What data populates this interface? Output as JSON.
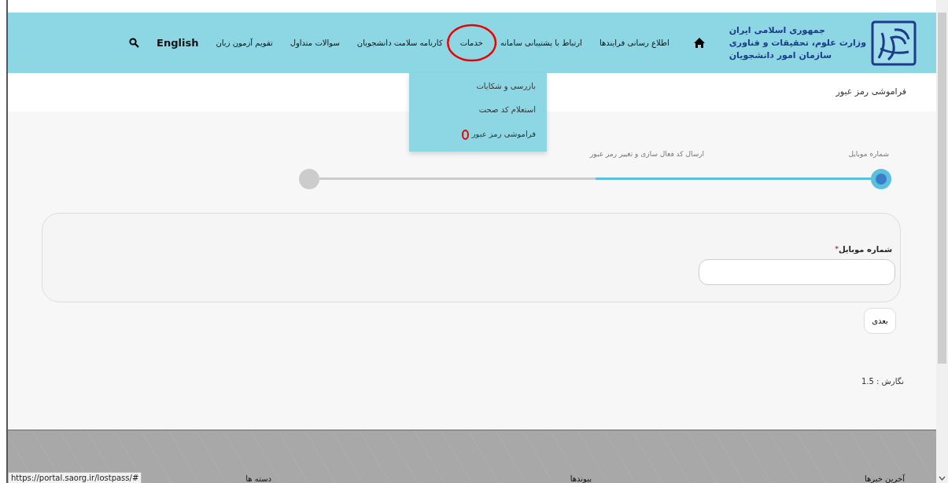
{
  "header": {
    "logo_lines": [
      "جمهوری اسلامی ایران",
      "وزارت علوم، تحقیقات و فناوری",
      "سازمان امور دانشجویان"
    ],
    "nav": [
      {
        "kind": "home"
      },
      {
        "kind": "link",
        "label": "اطلاع رسانی فرایندها",
        "circled": false
      },
      {
        "kind": "link",
        "label": "ارتباط با پشتیبانی سامانه",
        "circled": false
      },
      {
        "kind": "link",
        "label": "خدمات",
        "circled": true
      },
      {
        "kind": "link",
        "label": "کارنامه سلامت دانشجویان",
        "circled": false
      },
      {
        "kind": "link",
        "label": "سوالات متداول",
        "circled": false
      },
      {
        "kind": "link",
        "label": "تقویم آزمون زبان",
        "circled": false
      },
      {
        "kind": "lang",
        "label": "English"
      },
      {
        "kind": "search"
      }
    ]
  },
  "dropdown": [
    {
      "label": "بازرسی و شکایات",
      "circled": false
    },
    {
      "label": "استعلام کد صحت",
      "circled": false
    },
    {
      "label": "فراموشی رمز عبور",
      "circled": true
    }
  ],
  "breadcrumb": "فراموشی رمز عبور",
  "steps": {
    "level": 0.5,
    "items": [
      {
        "label": "شماره موبایل",
        "selected": true
      },
      {
        "label": "ارسال کد فعال سازی و تغییر رمز عبور",
        "selected": false
      }
    ]
  },
  "form": {
    "label": "شماره موبایل",
    "required_mark": "*"
  },
  "next_button": "بعدی",
  "version": "نگارش : 1.5",
  "footer": {
    "columns": [
      "آخرین خبرها",
      "پیوندها",
      "دسته ها"
    ]
  },
  "status_url": "https://portal.saorg.ir/lostpass/#"
}
